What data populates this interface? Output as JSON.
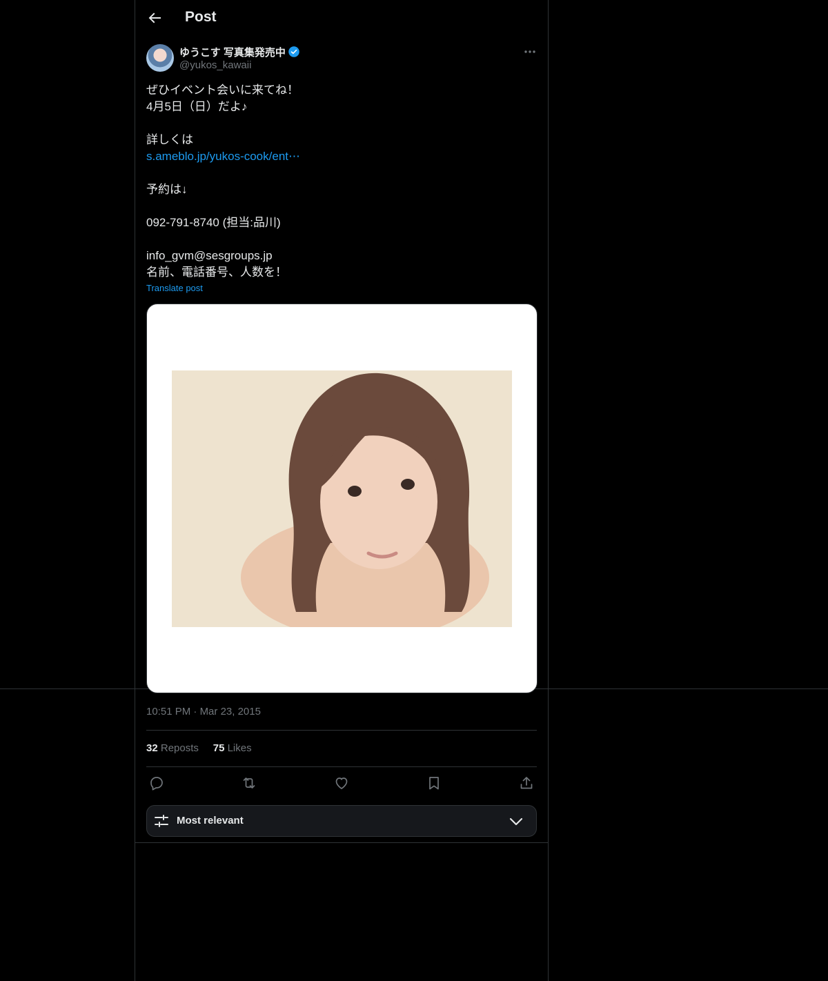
{
  "header": {
    "title": "Post",
    "back_icon": "arrow-left-icon"
  },
  "author": {
    "name": "ゆうこす 写真集発売中",
    "handle": "@yukos_kawaii",
    "verified": true,
    "verified_color": "#1d9bf0"
  },
  "post": {
    "lines": [
      "ぜひイベント会いに来てね！",
      "4月5日（日）だよ♪",
      "",
      "詳しくは",
      "s.ameblo.jp/yukos-cook/ent⋯",
      "",
      "予約は↓",
      "",
      "092-791-8740 (担当:品川)",
      "",
      "info_gvm@sesgroups.jp",
      "名前、電話番号、人数を！"
    ],
    "link_line_index": 4,
    "translate_label": "Translate post"
  },
  "meta": {
    "time": "10:51 PM",
    "dot": "·",
    "date": "Mar 23, 2015"
  },
  "stats": {
    "reposts_count": "32",
    "reposts_label": "Reposts",
    "likes_count": "75",
    "likes_label": "Likes"
  },
  "actions": [
    "reply-icon",
    "repost-icon",
    "like-icon",
    "bookmark-icon",
    "share-icon"
  ],
  "replies_sort": {
    "label": "Most relevant"
  },
  "colors": {
    "background": "#000000",
    "text": "#e7e9ea",
    "muted": "#71767b",
    "accent": "#1d9bf0",
    "border": "#2f3336"
  }
}
